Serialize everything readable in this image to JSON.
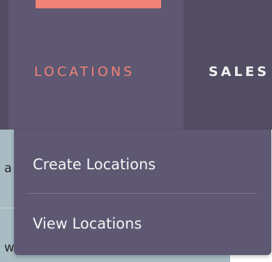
{
  "nav": {
    "items": [
      {
        "label": "LOCATIONS",
        "active": true
      },
      {
        "label": "SALES",
        "active": false
      }
    ]
  },
  "dropdown": {
    "items": [
      {
        "label": "Create Locations"
      },
      {
        "label": "View Locations"
      }
    ]
  },
  "underlay": {
    "fragments": [
      "a",
      "w"
    ]
  },
  "colors": {
    "nav_background": "#534d64",
    "nav_active_background": "#5e5872",
    "accent": "#f08377",
    "dropdown_background": "#5e5872",
    "underlay_panel": "#a9bcc3"
  }
}
